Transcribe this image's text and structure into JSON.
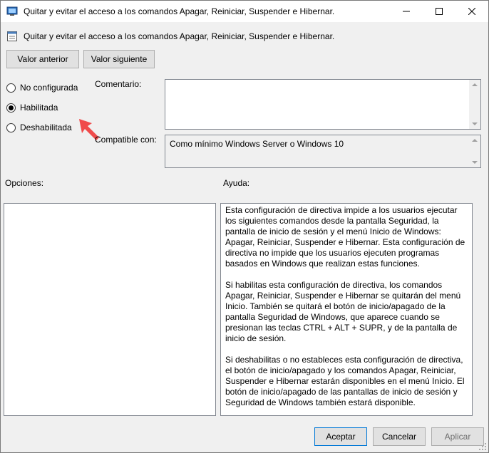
{
  "window": {
    "title": "Quitar y evitar el acceso a los comandos Apagar, Reiniciar, Suspender e Hibernar.",
    "icons": {
      "app": "policy-window-icon",
      "minimize": "minimize-icon",
      "maximize": "maximize-icon",
      "close": "close-icon"
    }
  },
  "policy": {
    "name": "Quitar y evitar el acceso a los comandos Apagar, Reiniciar, Suspender e Hibernar.",
    "icon": "policy-settings-icon"
  },
  "navigation": {
    "previous_label": "Valor anterior",
    "next_label": "Valor siguiente"
  },
  "state_options": [
    {
      "label": "No configurada",
      "checked": false
    },
    {
      "label": "Habilitada",
      "checked": true
    },
    {
      "label": "Deshabilitada",
      "checked": false
    }
  ],
  "comment": {
    "label": "Comentario:",
    "value": ""
  },
  "compatibility": {
    "label": "Compatible con:",
    "value": "Como mínimo Windows Server o Windows 10"
  },
  "options": {
    "label": "Opciones:"
  },
  "help": {
    "label": "Ayuda:",
    "paragraphs": [
      "Esta configuración de directiva impide a los usuarios ejecutar los siguientes comandos desde la pantalla Seguridad, la pantalla de inicio de sesión y el menú Inicio de Windows: Apagar, Reiniciar, Suspender e Hibernar. Esta configuración de directiva no impide que los usuarios ejecuten programas basados en Windows que realizan estas funciones.",
      "Si habilitas esta configuración de directiva, los comandos Apagar, Reiniciar, Suspender e Hibernar se quitarán del menú Inicio. También se quitará el botón de inicio/apagado de la pantalla Seguridad de Windows, que aparece cuando se presionan las teclas CTRL + ALT + SUPR, y de la pantalla de inicio de sesión.",
      "Si deshabilitas o no estableces esta configuración de directiva, el botón de inicio/apagado y los comandos Apagar, Reiniciar, Suspender e Hibernar estarán disponibles en el menú Inicio. El botón de inicio/apagado de las pantallas de inicio de sesión y Seguridad de Windows también estará disponible."
    ]
  },
  "footer": {
    "ok_label": "Aceptar",
    "cancel_label": "Cancelar",
    "apply_label": "Aplicar"
  },
  "colors": {
    "accent": "#0078d7",
    "annotation_arrow": "#f04a4a"
  }
}
